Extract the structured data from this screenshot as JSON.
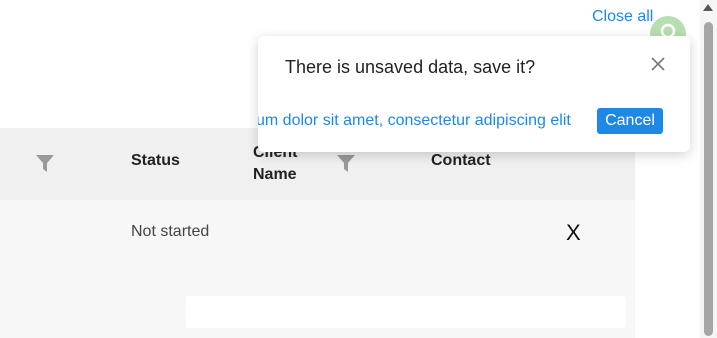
{
  "toolbar": {
    "close_all_label": "Close all"
  },
  "table": {
    "columns": {
      "status": "Status",
      "client_name": "Client\nName",
      "contact": "Contact"
    },
    "rows": [
      {
        "status": "Not started",
        "close_symbol": "X"
      }
    ]
  },
  "dialog": {
    "message": "There is unsaved data, save it?",
    "scrolling_text": "um dolor sit amet, consectetur adipiscing elit",
    "cancel_label": "Cancel"
  },
  "icons": {
    "filter": "filter-icon",
    "close": "close-icon",
    "avatar": "user-avatar-icon"
  },
  "colors": {
    "accent": "#1e88e5",
    "header_bg": "#f0f0f0",
    "body_bg": "#f7f7f7",
    "avatar_bg": "#b7dfb0"
  }
}
